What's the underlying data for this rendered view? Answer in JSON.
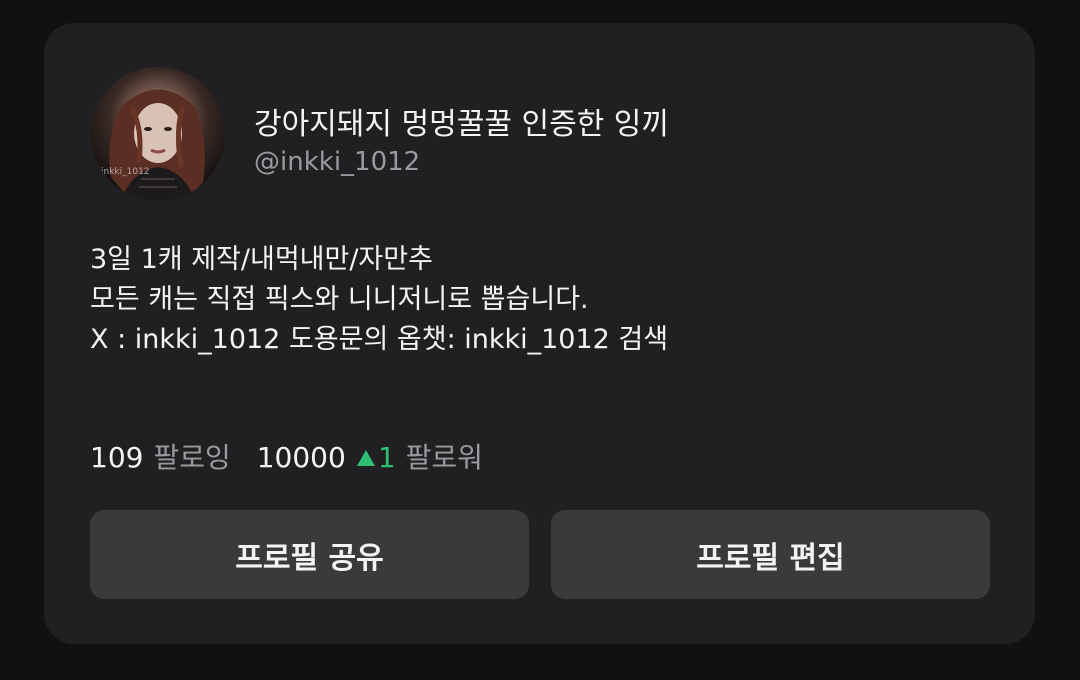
{
  "profile": {
    "display_name": "강아지돼지 멍멍꿀꿀 인증한 잉끼",
    "handle": "@inkki_1012",
    "avatar_watermark": "inkki_1012",
    "bio": [
      "3일 1캐 제작/내먹내만/자만추",
      "모든 캐는 직접 픽스와 니니저니로 뽑습니다.",
      "X :  inkki_1012 도용문의 옵챗: inkki_1012 검색"
    ]
  },
  "stats": {
    "following_count": "109",
    "following_label": "팔로잉",
    "followers_count": "10000",
    "followers_delta": "1",
    "followers_label": "팔로워",
    "delta_icon": "triangle-up-icon",
    "delta_color": "#2fbf71"
  },
  "buttons": {
    "share_label": "프로필 공유",
    "edit_label": "프로필 편집"
  }
}
